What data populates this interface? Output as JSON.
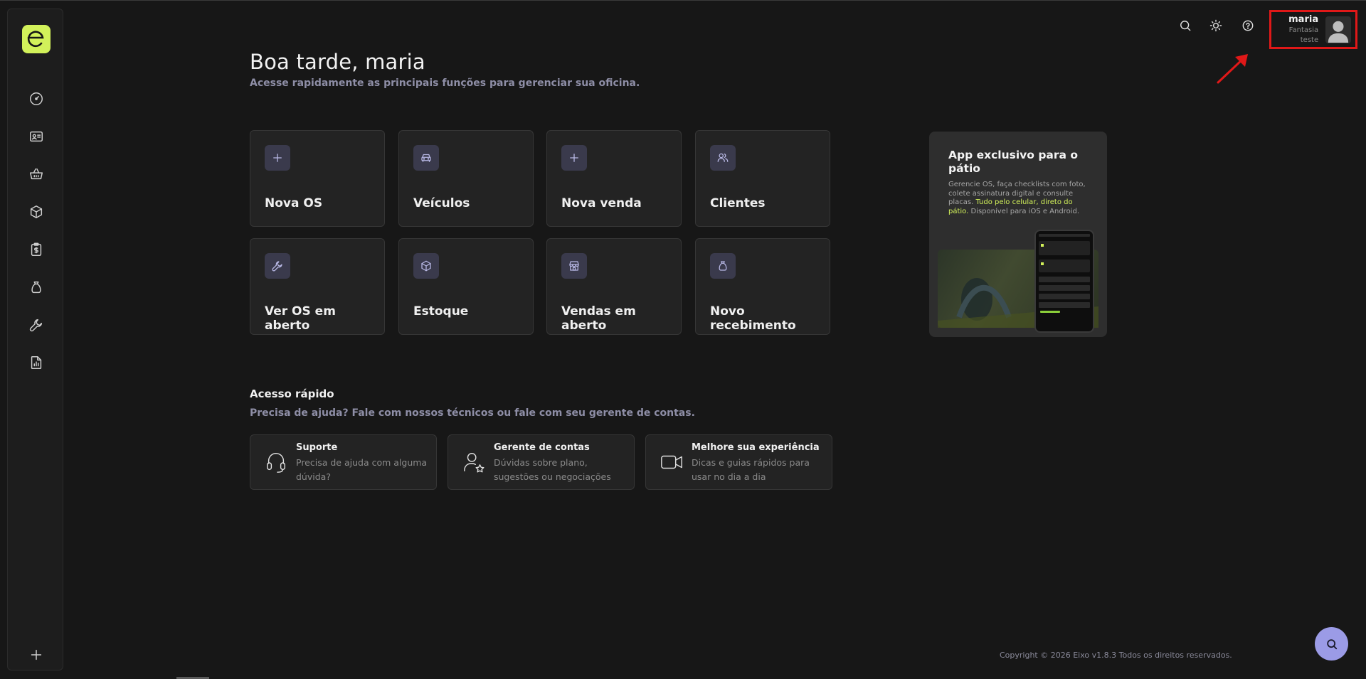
{
  "sidebar": {
    "logo_letter": "e",
    "items": [
      {
        "name": "dashboard-icon"
      },
      {
        "name": "id-card-icon"
      },
      {
        "name": "basket-icon"
      },
      {
        "name": "box-icon"
      },
      {
        "name": "clipboard-dollar-icon"
      },
      {
        "name": "money-bag-icon"
      },
      {
        "name": "wrench-icon"
      },
      {
        "name": "report-icon"
      }
    ],
    "add_icon": "plus-icon"
  },
  "topbar": {
    "icons": [
      "search-icon",
      "sun-icon",
      "help-icon"
    ],
    "user": {
      "name": "maria",
      "company": "Fantasia teste"
    }
  },
  "greeting": {
    "title": "Boa tarde, maria",
    "subtitle": "Acesse rapidamente as principais funções para gerenciar sua oficina."
  },
  "tiles": [
    {
      "label": "Nova OS",
      "icon": "plus-icon"
    },
    {
      "label": "Veículos",
      "icon": "car-icon"
    },
    {
      "label": "Nova venda",
      "icon": "plus-icon"
    },
    {
      "label": "Clientes",
      "icon": "users-icon"
    },
    {
      "label": "Ver OS em aberto",
      "icon": "wrench-icon"
    },
    {
      "label": "Estoque",
      "icon": "box-icon"
    },
    {
      "label": "Vendas em aberto",
      "icon": "store-icon"
    },
    {
      "label": "Novo recebimento",
      "icon": "money-bag-icon"
    }
  ],
  "promo": {
    "title": "App exclusivo para o pátio",
    "text_1": "Gerencie OS, faça checklists com foto, colete assinatura digital e consulte placas. ",
    "text_highlight": "Tudo pelo celular, direto do pátio.",
    "text_2": " Disponível para iOS e Android."
  },
  "quick_access": {
    "title": "Acesso rápido",
    "subtitle": "Precisa de ajuda? Fale com nossos técnicos ou fale com seu gerente de contas.",
    "cards": [
      {
        "title": "Suporte",
        "desc": "Precisa de ajuda com alguma dúvida?",
        "icon": "headset-icon"
      },
      {
        "title": "Gerente de contas",
        "desc": "Dúvidas sobre plano, sugestões ou negociações",
        "icon": "user-star-icon"
      },
      {
        "title": "Melhore sua experiência",
        "desc": "Dicas e guias rápidos para usar no dia a dia",
        "icon": "video-icon"
      }
    ]
  },
  "footer": {
    "text": "Copyright © 2026 Eixo v1.8.3 Todos os direitos reservados."
  },
  "colors": {
    "accent": "#d2f15a",
    "tile_icon_bg": "#3a3a4c",
    "fab": "#9b9be6",
    "highlight_border": "#e01818"
  }
}
